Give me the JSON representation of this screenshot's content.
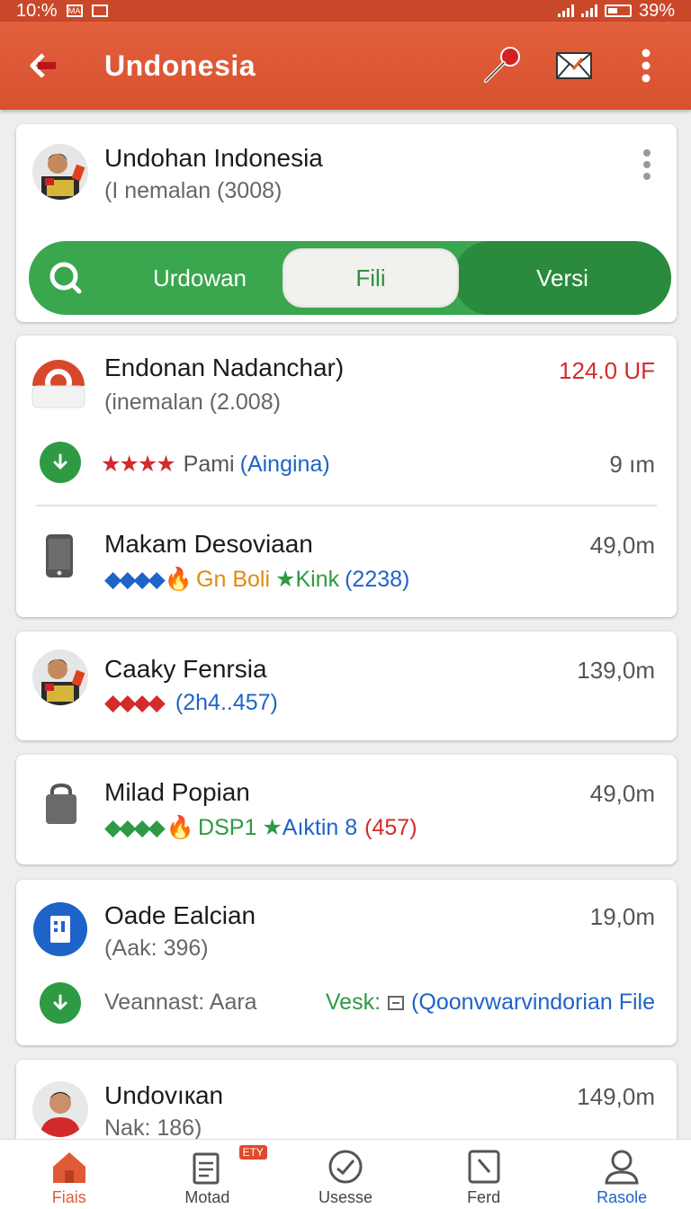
{
  "status_bar": {
    "time": "10:%",
    "badge1": "MA",
    "battery": "39%"
  },
  "app_bar": {
    "title": "Undonesia"
  },
  "profile": {
    "name": "Undohan Indonesia",
    "subtitle": "(I nemalan (3008)",
    "segments": [
      "Urdowan",
      "Fili",
      "Versi"
    ]
  },
  "list": [
    {
      "title": "Endonan Nadanchar)",
      "subtitle": "(inemalan (2.008)",
      "value": "124.0 UF",
      "value_color": "#d62b2b",
      "detail": {
        "stars": "★★★★",
        "label": "Pami",
        "link": "(Aingina)",
        "right": "9 ım"
      }
    },
    {
      "title": "Makam Desoviaan",
      "value": "49,0m",
      "rating": {
        "gems": "◆◆◆◆",
        "a": "Gn Boli",
        "b": "Kink",
        "c": "(2238)"
      }
    },
    {
      "title": "Caaky Fenrsia",
      "value": "139,0m",
      "rating": {
        "gems": "◆◆◆◆",
        "c": "(2h4..457)"
      }
    },
    {
      "title": "Milad Popian",
      "value": "49,0m",
      "rating": {
        "gems": "◆◆◆◆",
        "a": "DSP1",
        "b": "Aıktin 8",
        "c": "(457)"
      }
    },
    {
      "title": "Oade Ealcian",
      "subtitle": "(Ааk: 396)",
      "value": "19,0m",
      "detail": {
        "label": "Veannast: Aara",
        "right_a": "Vesk:",
        "right_b": "(Qoonvwarvindorian File"
      }
    },
    {
      "title": "Undovıкan",
      "subtitle": "Nak: 186)",
      "value": "149,0m"
    }
  ],
  "bottom_nav": [
    {
      "label": "Fiais",
      "icon": "home-icon",
      "active": true
    },
    {
      "label": "Motad",
      "icon": "document-icon",
      "badge": "ETY"
    },
    {
      "label": "Usesse",
      "icon": "check-circle-icon"
    },
    {
      "label": "Ferd",
      "icon": "square-icon"
    },
    {
      "label": "Rasole",
      "icon": "profile-icon"
    }
  ],
  "colors": {
    "accent": "#e05a37",
    "green": "#3aa64e",
    "blue": "#1e63c8"
  }
}
